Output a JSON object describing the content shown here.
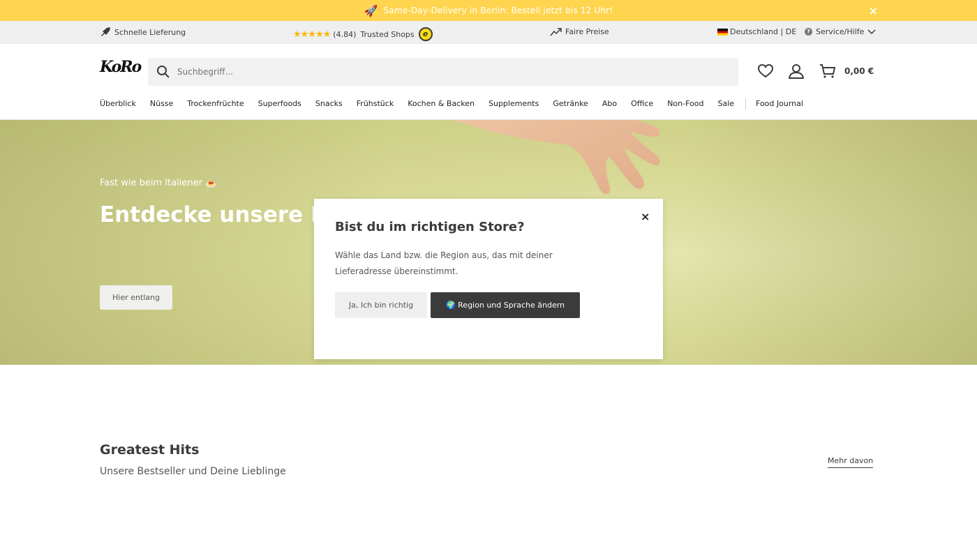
{
  "topbar": {
    "icon": "rocket-icon",
    "promo": "Same-Day-Delivery in Berlin: Bestell jetzt bis 12 Uhr!",
    "close": "×"
  },
  "usp": {
    "fast_delivery": "Schnelle Lieferung",
    "rating": "(4.84)",
    "stars": "★★★★★",
    "trusted": "Trusted Shops",
    "trusted_badge": "e",
    "fair_prices": "Faire Preise",
    "country": "Deutschland | DE",
    "service": "Service/Hilfe"
  },
  "header": {
    "logo": "KoRo",
    "search_placeholder": "Suchbegriff...",
    "cart_total": "0,00 €"
  },
  "nav": {
    "items": [
      "Überblick",
      "Nüsse",
      "Trockenfrüchte",
      "Superfoods",
      "Snacks",
      "Frühstück",
      "Kochen & Backen",
      "Supplements",
      "Getränke",
      "Abo",
      "Office",
      "Non-Food",
      "Sale"
    ],
    "journal": "Food Journal"
  },
  "hero": {
    "kicker": "Fast wie beim Italiener 🍝",
    "title": "Entdecke unsere K Kategorie",
    "cta": "Hier entlang"
  },
  "modal": {
    "title": "Bist du im richtigen Store?",
    "text": "Wähle das Land bzw. die Region aus, das mit deiner Lieferadresse übereinstimmt.",
    "confirm": "Ja, Ich bin richtig",
    "change": "🌍 Region und Sprache ändern",
    "close": "×"
  },
  "section": {
    "title": "Greatest Hits",
    "subtitle": "Unsere Bestseller und Deine Lieblinge",
    "more": "Mehr davon"
  },
  "colors": {
    "promo_bar": "#ffd54f",
    "hero_bg": "#d6d894",
    "dark_button": "#3b3b3b",
    "star": "#ffb400"
  }
}
